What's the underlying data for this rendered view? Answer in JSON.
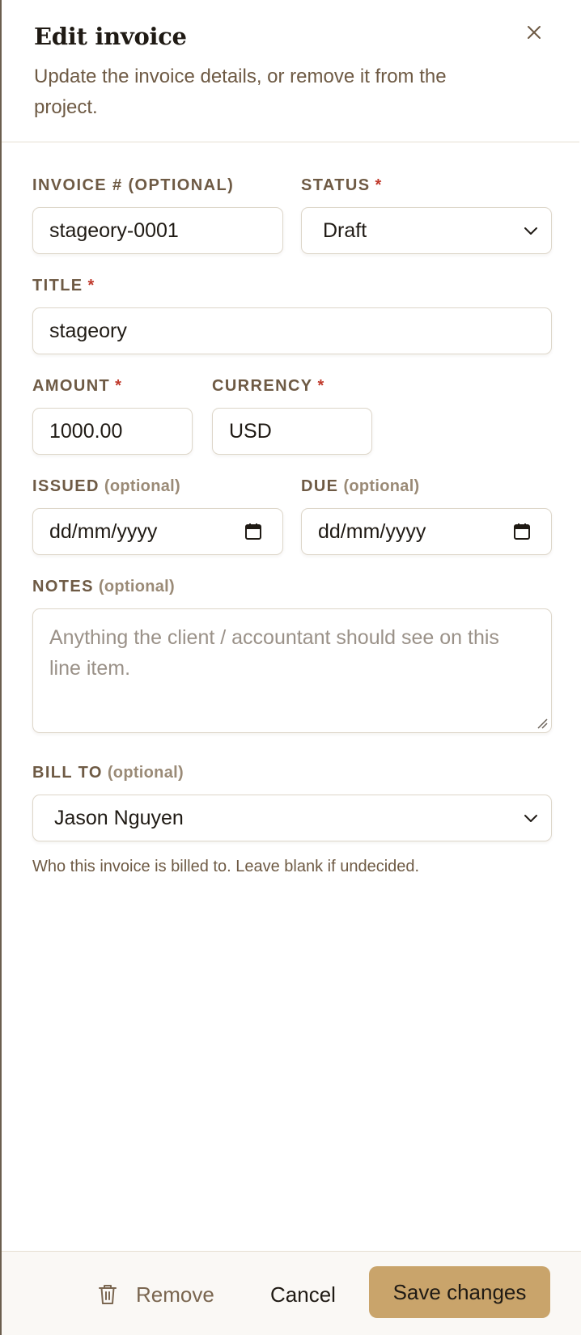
{
  "dialog": {
    "title": "Edit invoice",
    "subtitle": "Update the invoice details, or remove it from the project.",
    "close_icon": "close-icon"
  },
  "form": {
    "invoice_number": {
      "label": "INVOICE # (OPTIONAL)",
      "value": "stageory-0001"
    },
    "status": {
      "label": "STATUS",
      "required_mark": "*",
      "value": "Draft"
    },
    "title_field": {
      "label": "TITLE",
      "required_mark": "*",
      "value": "stageory"
    },
    "amount": {
      "label": "AMOUNT",
      "required_mark": "*",
      "value": "1000.00"
    },
    "currency": {
      "label": "CURRENCY",
      "required_mark": "*",
      "value": "USD"
    },
    "issued": {
      "label": "ISSUED",
      "optional": "(optional)",
      "placeholder": "dd/mm/yyyy"
    },
    "due": {
      "label": "DUE",
      "optional": "(optional)",
      "placeholder": "dd/mm/yyyy"
    },
    "notes": {
      "label": "NOTES",
      "optional": "(optional)",
      "placeholder": "Anything the client / accountant should see on this line item."
    },
    "bill_to": {
      "label": "BILL TO",
      "optional": "(optional)",
      "value": "Jason Nguyen",
      "hint": "Who this invoice is billed to. Leave blank if undecided."
    }
  },
  "footer": {
    "remove_label": "Remove",
    "cancel_label": "Cancel",
    "save_label": "Save changes"
  },
  "colors": {
    "accent": "#c9a46b",
    "label": "#6e5a44",
    "required": "#c0392b",
    "border": "#ddd6c9"
  }
}
